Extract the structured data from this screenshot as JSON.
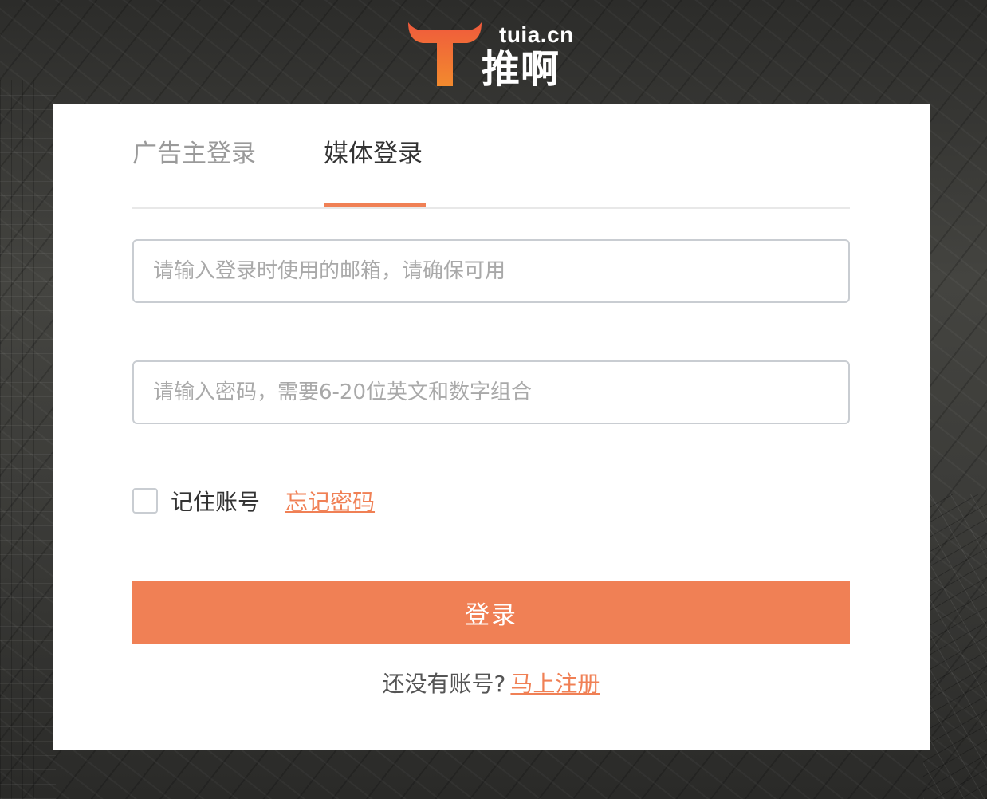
{
  "brand": {
    "domain": "tuia.cn",
    "name": "推啊",
    "accent_color": "#f08055",
    "logo_icon": "bull-horns-t-logo"
  },
  "tabs": [
    {
      "label": "广告主登录",
      "active": false
    },
    {
      "label": "媒体登录",
      "active": true
    }
  ],
  "form": {
    "email_placeholder": "请输入登录时使用的邮箱，请确保可用",
    "email_value": "",
    "password_placeholder": "请输入密码，需要6-20位英文和数字组合",
    "password_value": "",
    "remember_label": "记住账号",
    "remember_checked": false,
    "forgot_label": "忘记密码",
    "submit_label": "登录"
  },
  "register": {
    "prompt": "还没有账号?",
    "link_label": "马上注册"
  }
}
